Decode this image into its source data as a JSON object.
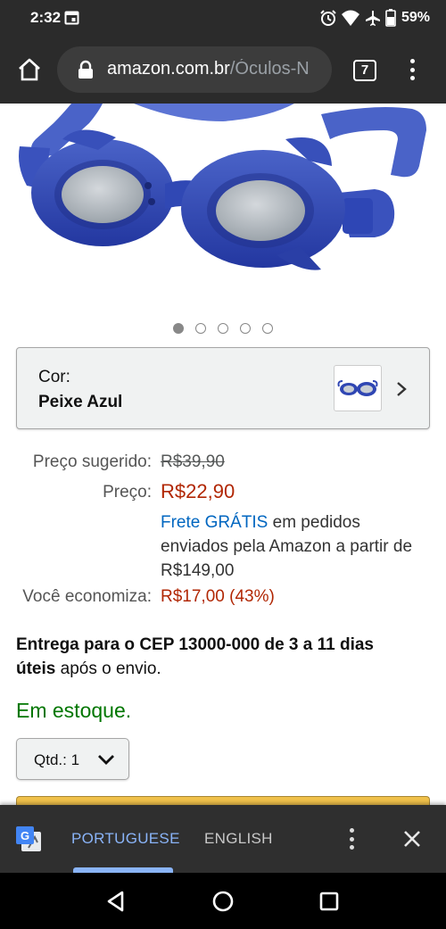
{
  "status_bar": {
    "time": "2:32",
    "battery": "59%"
  },
  "browser": {
    "url_domain": "amazon.com.br",
    "url_path": "/Óculos-N",
    "tab_count": "7"
  },
  "product": {
    "carousel_count": 5,
    "carousel_active_index": 0,
    "color_label": "Cor:",
    "color_value": "Peixe Azul",
    "list_price_label": "Preço sugerido:",
    "list_price": "R$39,90",
    "price_label": "Preço:",
    "price": "R$22,90",
    "shipping_link": "Frete GRÁTIS",
    "shipping_rest": " em pedidos enviados pela Amazon a partir de R$149,00",
    "savings_label": "Você economiza:",
    "savings": "R$17,00 (43%)",
    "delivery_bold_1": "Entrega para o CEP 13000-000 de 3 a 11 dias úteis",
    "delivery_rest": " após o envio.",
    "stock": "Em estoque.",
    "quantity_label": "Qtd.: 1"
  },
  "translate_bar": {
    "lang_source": "PORTUGUESE",
    "lang_target": "ENGLISH"
  },
  "colors": {
    "price_red": "#b12704",
    "link_blue": "#0066c0",
    "stock_green": "#007600",
    "chrome_dark": "#2b2b2b",
    "translate_accent": "#8ab4f8"
  }
}
